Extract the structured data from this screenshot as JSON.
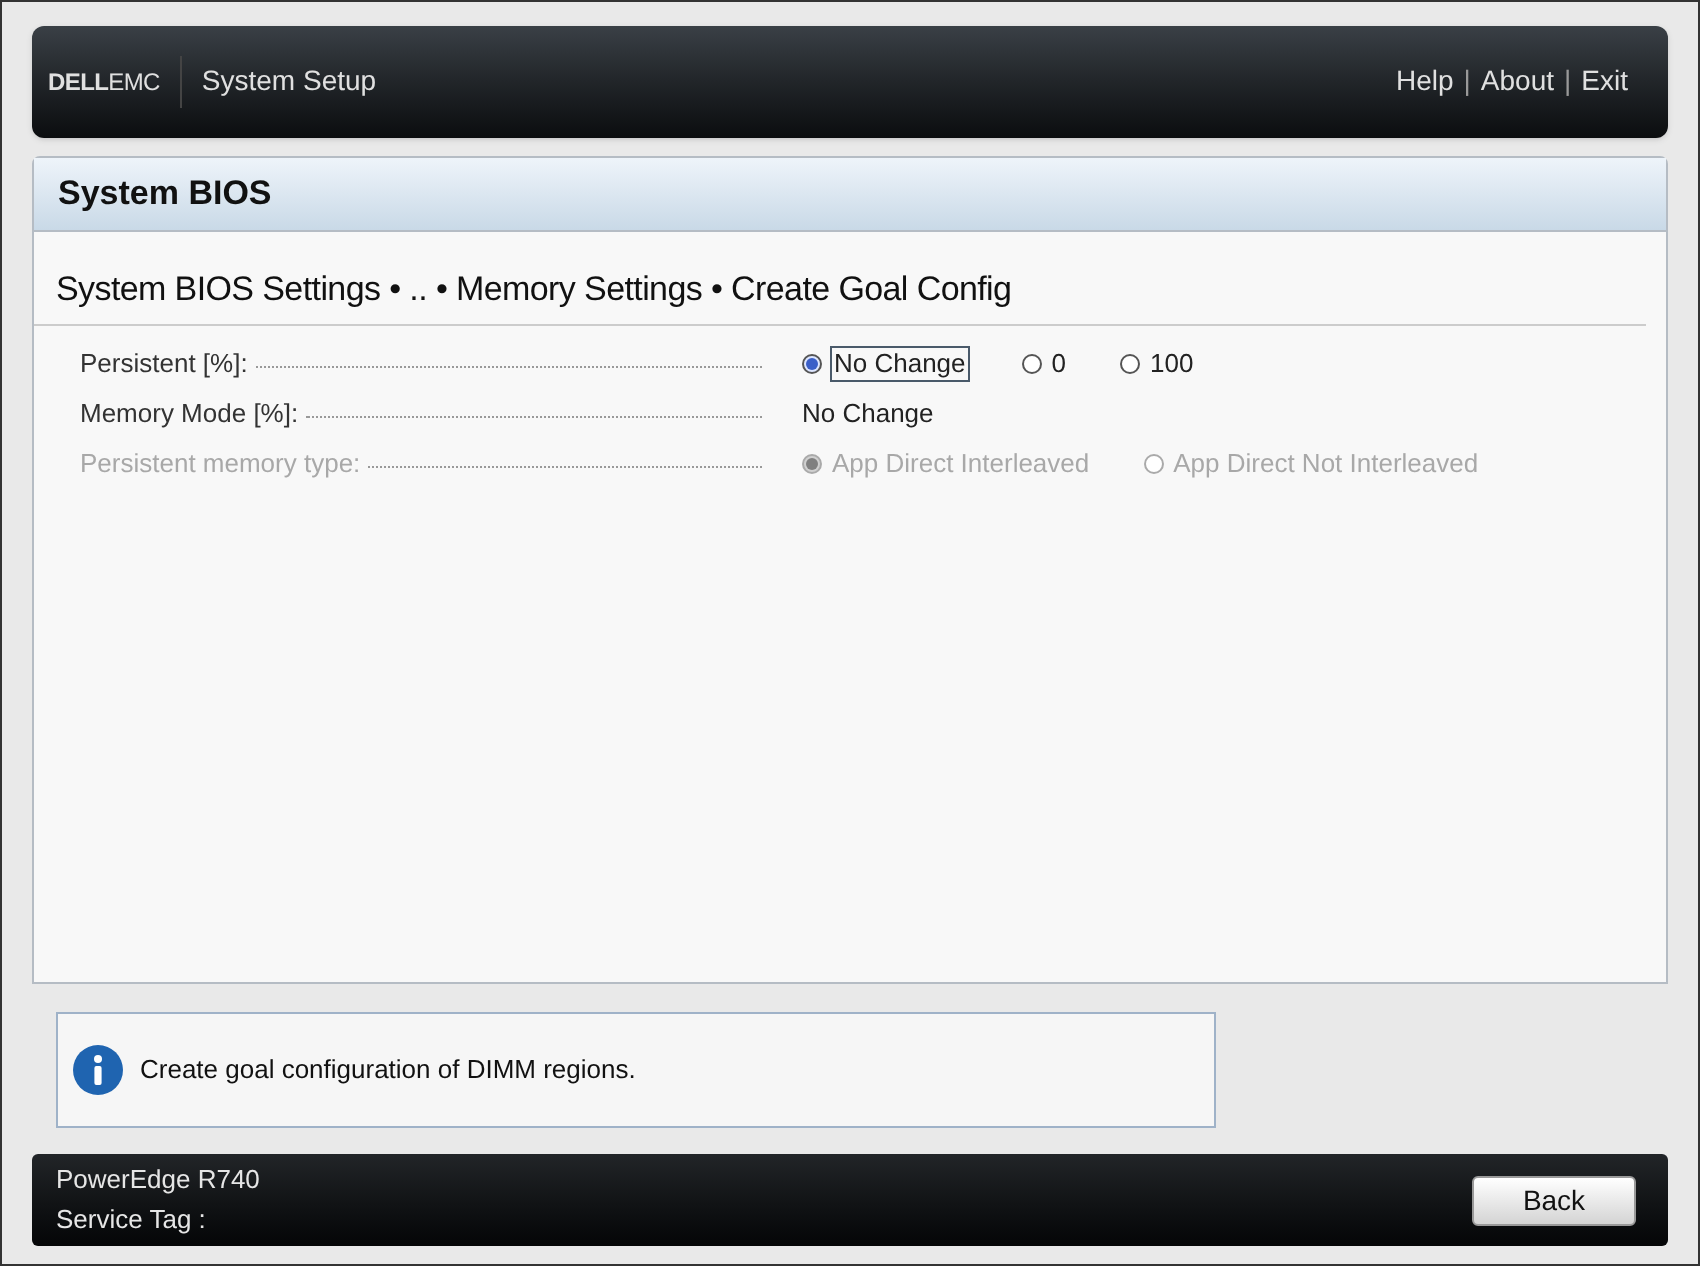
{
  "header": {
    "logo": {
      "bold": "DELL",
      "light": "EMC"
    },
    "title": "System Setup",
    "links": [
      {
        "kind": "link",
        "label": "Help"
      },
      {
        "kind": "separator",
        "label": "|"
      },
      {
        "kind": "link",
        "label": "About"
      },
      {
        "kind": "separator",
        "label": "|"
      },
      {
        "kind": "link",
        "label": "Exit"
      }
    ]
  },
  "panel": {
    "title": "System BIOS",
    "breadcrumb": "System BIOS Settings • .. • Memory Settings • Create Goal Config",
    "settings": [
      {
        "kind": "radio",
        "label": "Persistent [%]:",
        "disabled": false,
        "options": [
          {
            "label": "No Change",
            "selected": true,
            "focused": true
          },
          {
            "label": "0",
            "selected": false,
            "focused": false
          },
          {
            "label": "100",
            "selected": false,
            "focused": false
          }
        ]
      },
      {
        "kind": "text",
        "label": "Memory Mode [%]:",
        "disabled": false,
        "value": "No Change"
      },
      {
        "kind": "radio",
        "label": "Persistent memory type:",
        "disabled": true,
        "options": [
          {
            "label": "App Direct Interleaved",
            "selected": true,
            "focused": false
          },
          {
            "label": "App Direct Not Interleaved",
            "selected": false,
            "focused": false
          }
        ]
      }
    ]
  },
  "info": {
    "text": "Create goal configuration of DIMM regions."
  },
  "footer": {
    "model": "PowerEdge R740",
    "service_tag": "Service Tag :",
    "button": "Back"
  }
}
